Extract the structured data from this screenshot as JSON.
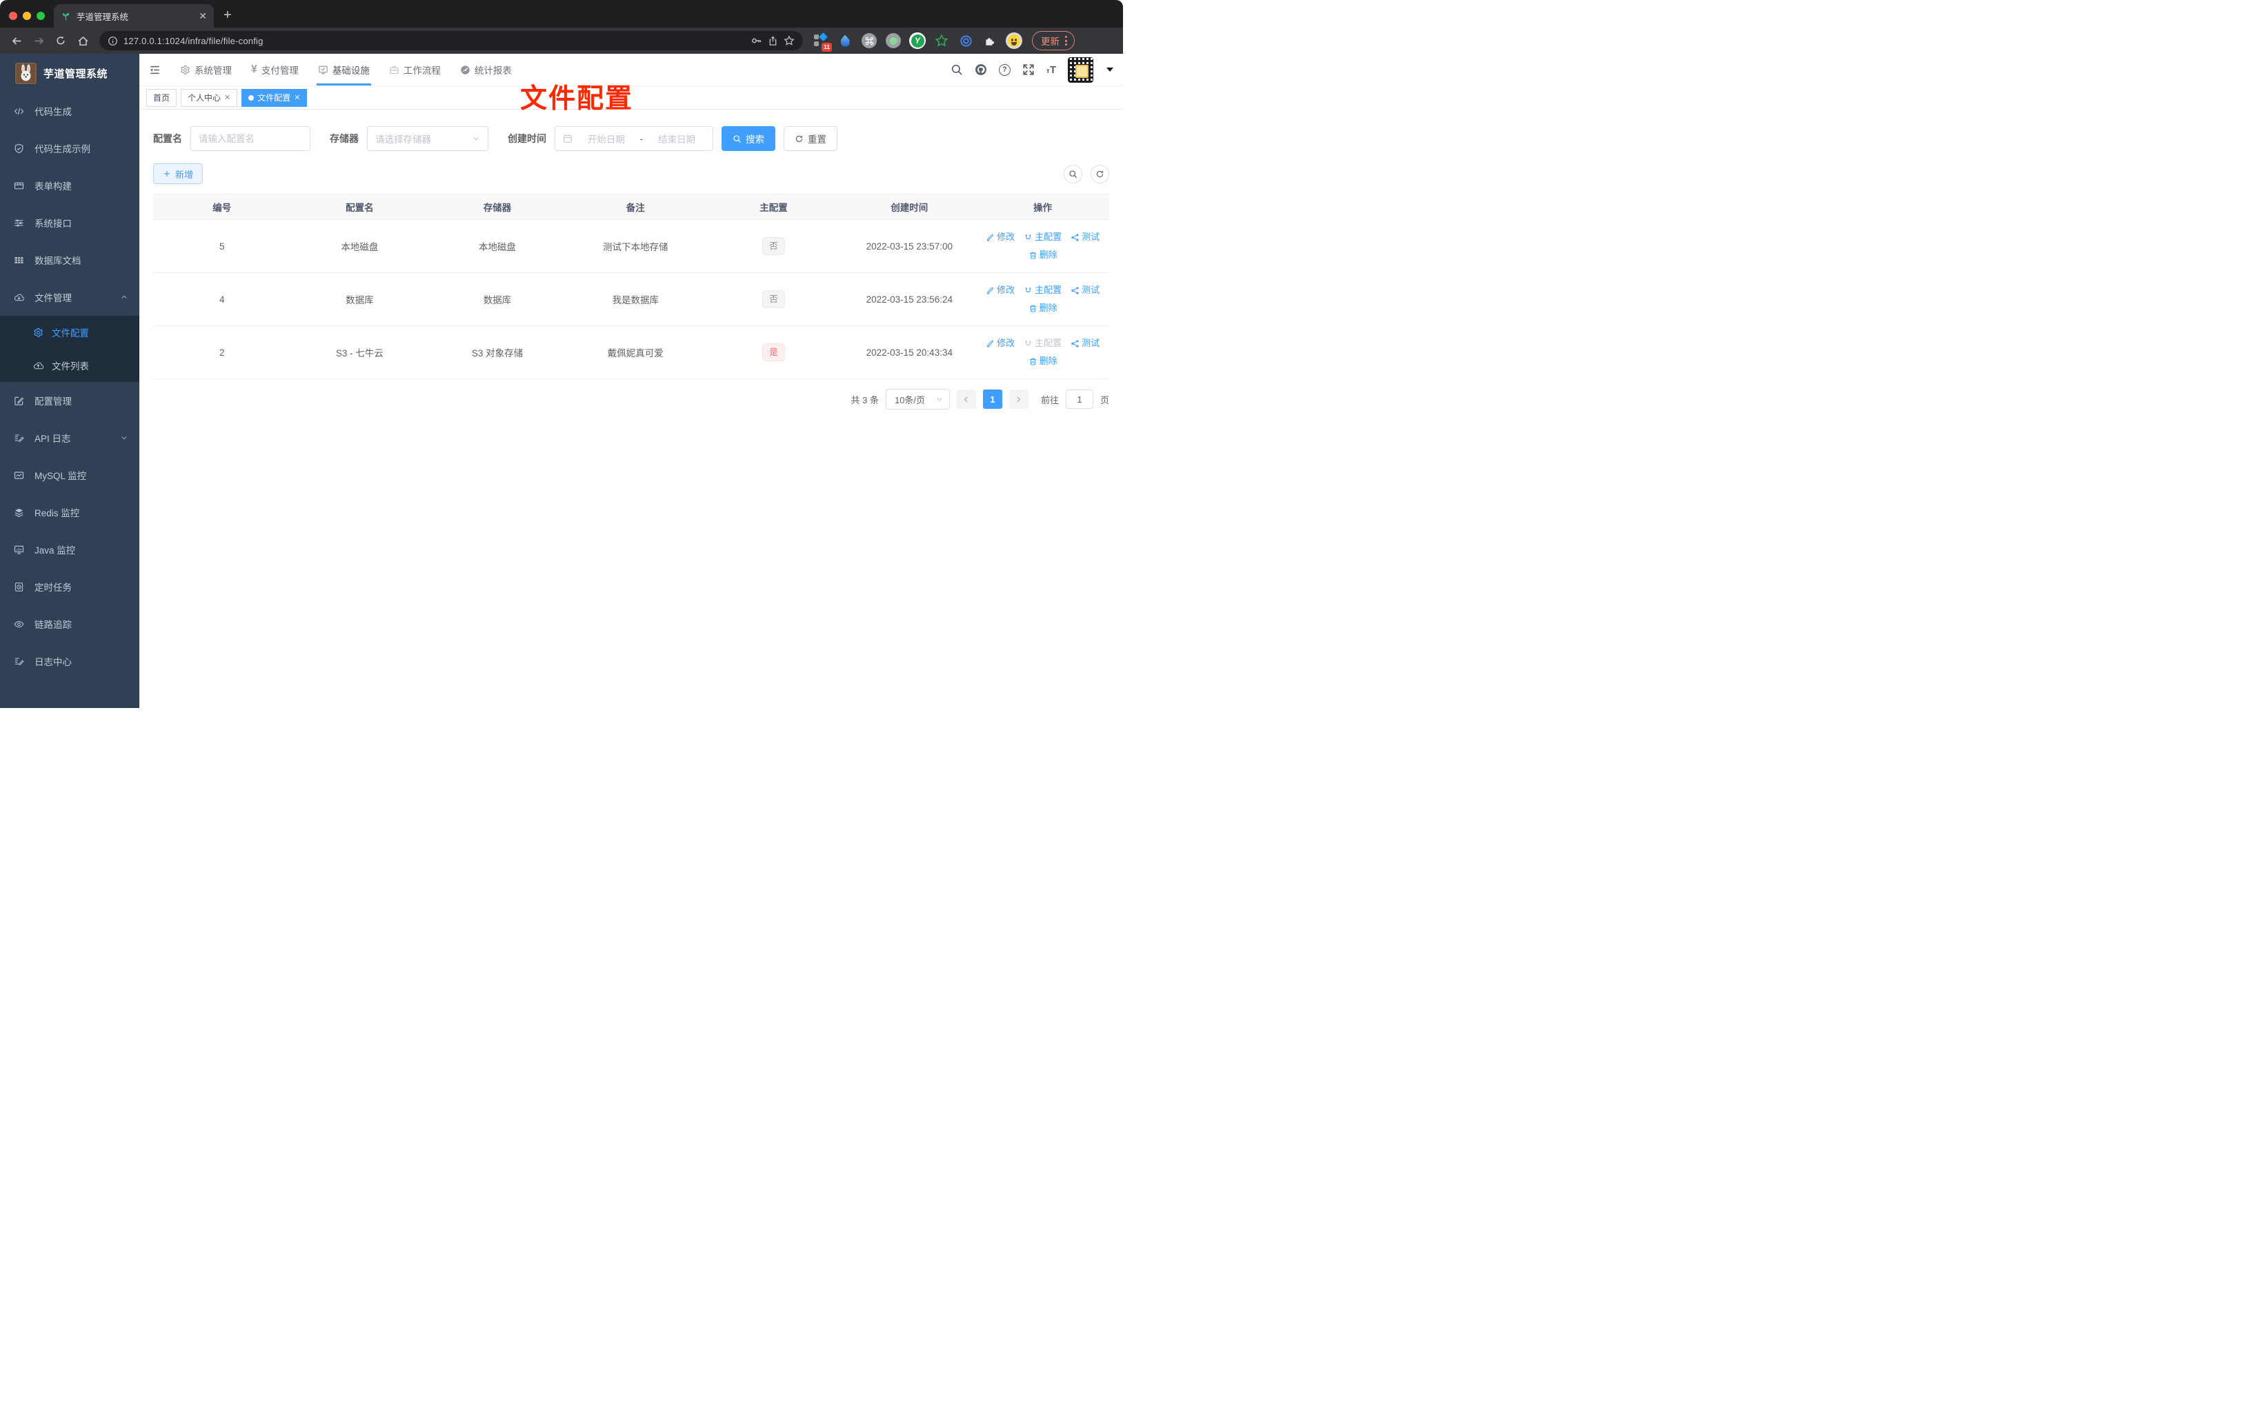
{
  "colors": {
    "accent": "#409eff",
    "danger": "#f56c6c",
    "annotation_red": "#fd2a00",
    "sidebar_bg": "#304156",
    "submenu_bg": "#1f2d3d"
  },
  "browser": {
    "tab_title": "芋道管理系统",
    "url": "127.0.0.1:1024/infra/file/file-config",
    "extensions_badge": "11",
    "profile_initial": "Y",
    "update_label": "更新"
  },
  "sidebar": {
    "logo_title": "芋道管理系统",
    "items": [
      {
        "label": "代码生成"
      },
      {
        "label": "代码生成示例"
      },
      {
        "label": "表单构建"
      },
      {
        "label": "系统接口"
      },
      {
        "label": "数据库文档"
      },
      {
        "label": "文件管理",
        "expanded": true,
        "children": [
          {
            "label": "文件配置",
            "active": true
          },
          {
            "label": "文件列表"
          }
        ]
      },
      {
        "label": "配置管理"
      },
      {
        "label": "API 日志",
        "collapsed": true
      },
      {
        "label": "MySQL 监控"
      },
      {
        "label": "Redis 监控"
      },
      {
        "label": "Java 监控"
      },
      {
        "label": "定时任务"
      },
      {
        "label": "链路追踪"
      },
      {
        "label": "日志中心"
      }
    ]
  },
  "topnav": {
    "items": [
      {
        "label": "系统管理"
      },
      {
        "label": "支付管理"
      },
      {
        "label": "基础设施",
        "active": true
      },
      {
        "label": "工作流程"
      },
      {
        "label": "统计报表"
      }
    ]
  },
  "tags": [
    {
      "label": "首页"
    },
    {
      "label": "个人中心",
      "closable": true
    },
    {
      "label": "文件配置",
      "closable": true,
      "active": true
    }
  ],
  "annotation": "文件配置",
  "filters": {
    "name_label": "配置名",
    "name_placeholder": "请输入配置名",
    "storage_label": "存储器",
    "storage_placeholder": "请选择存储器",
    "date_label": "创建时间",
    "date_start": "开始日期",
    "date_separator": "-",
    "date_end": "结束日期",
    "search_label": "搜索",
    "reset_label": "重置"
  },
  "toolbar": {
    "add_label": "新增"
  },
  "table": {
    "columns": [
      "编号",
      "配置名",
      "存储器",
      "备注",
      "主配置",
      "创建时间",
      "操作"
    ],
    "rows": [
      {
        "id": "5",
        "name": "本地磁盘",
        "storage": "本地磁盘",
        "remark": "测试下本地存储",
        "primary": "否",
        "primary_type": "info",
        "created": "2022-03-15 23:57:00",
        "actions": {
          "edit": "修改",
          "master": "主配置",
          "test": "测试",
          "delete": "删除"
        }
      },
      {
        "id": "4",
        "name": "数据库",
        "storage": "数据库",
        "remark": "我是数据库",
        "primary": "否",
        "primary_type": "info",
        "created": "2022-03-15 23:56:24",
        "actions": {
          "edit": "修改",
          "master": "主配置",
          "test": "测试",
          "delete": "删除"
        }
      },
      {
        "id": "2",
        "name": "S3 - 七牛云",
        "storage": "S3 对象存储",
        "remark": "戴佩妮真可爱",
        "primary": "是",
        "primary_type": "danger",
        "created": "2022-03-15 20:43:34",
        "actions": {
          "edit": "修改",
          "master": "主配置",
          "master_disabled": true,
          "test": "测试",
          "delete": "删除"
        }
      }
    ]
  },
  "pagination": {
    "total": "共 3 条",
    "page_size": "10条/页",
    "current_page": "1",
    "goto_label": "前往",
    "goto_value": "1",
    "page_unit": "页"
  }
}
